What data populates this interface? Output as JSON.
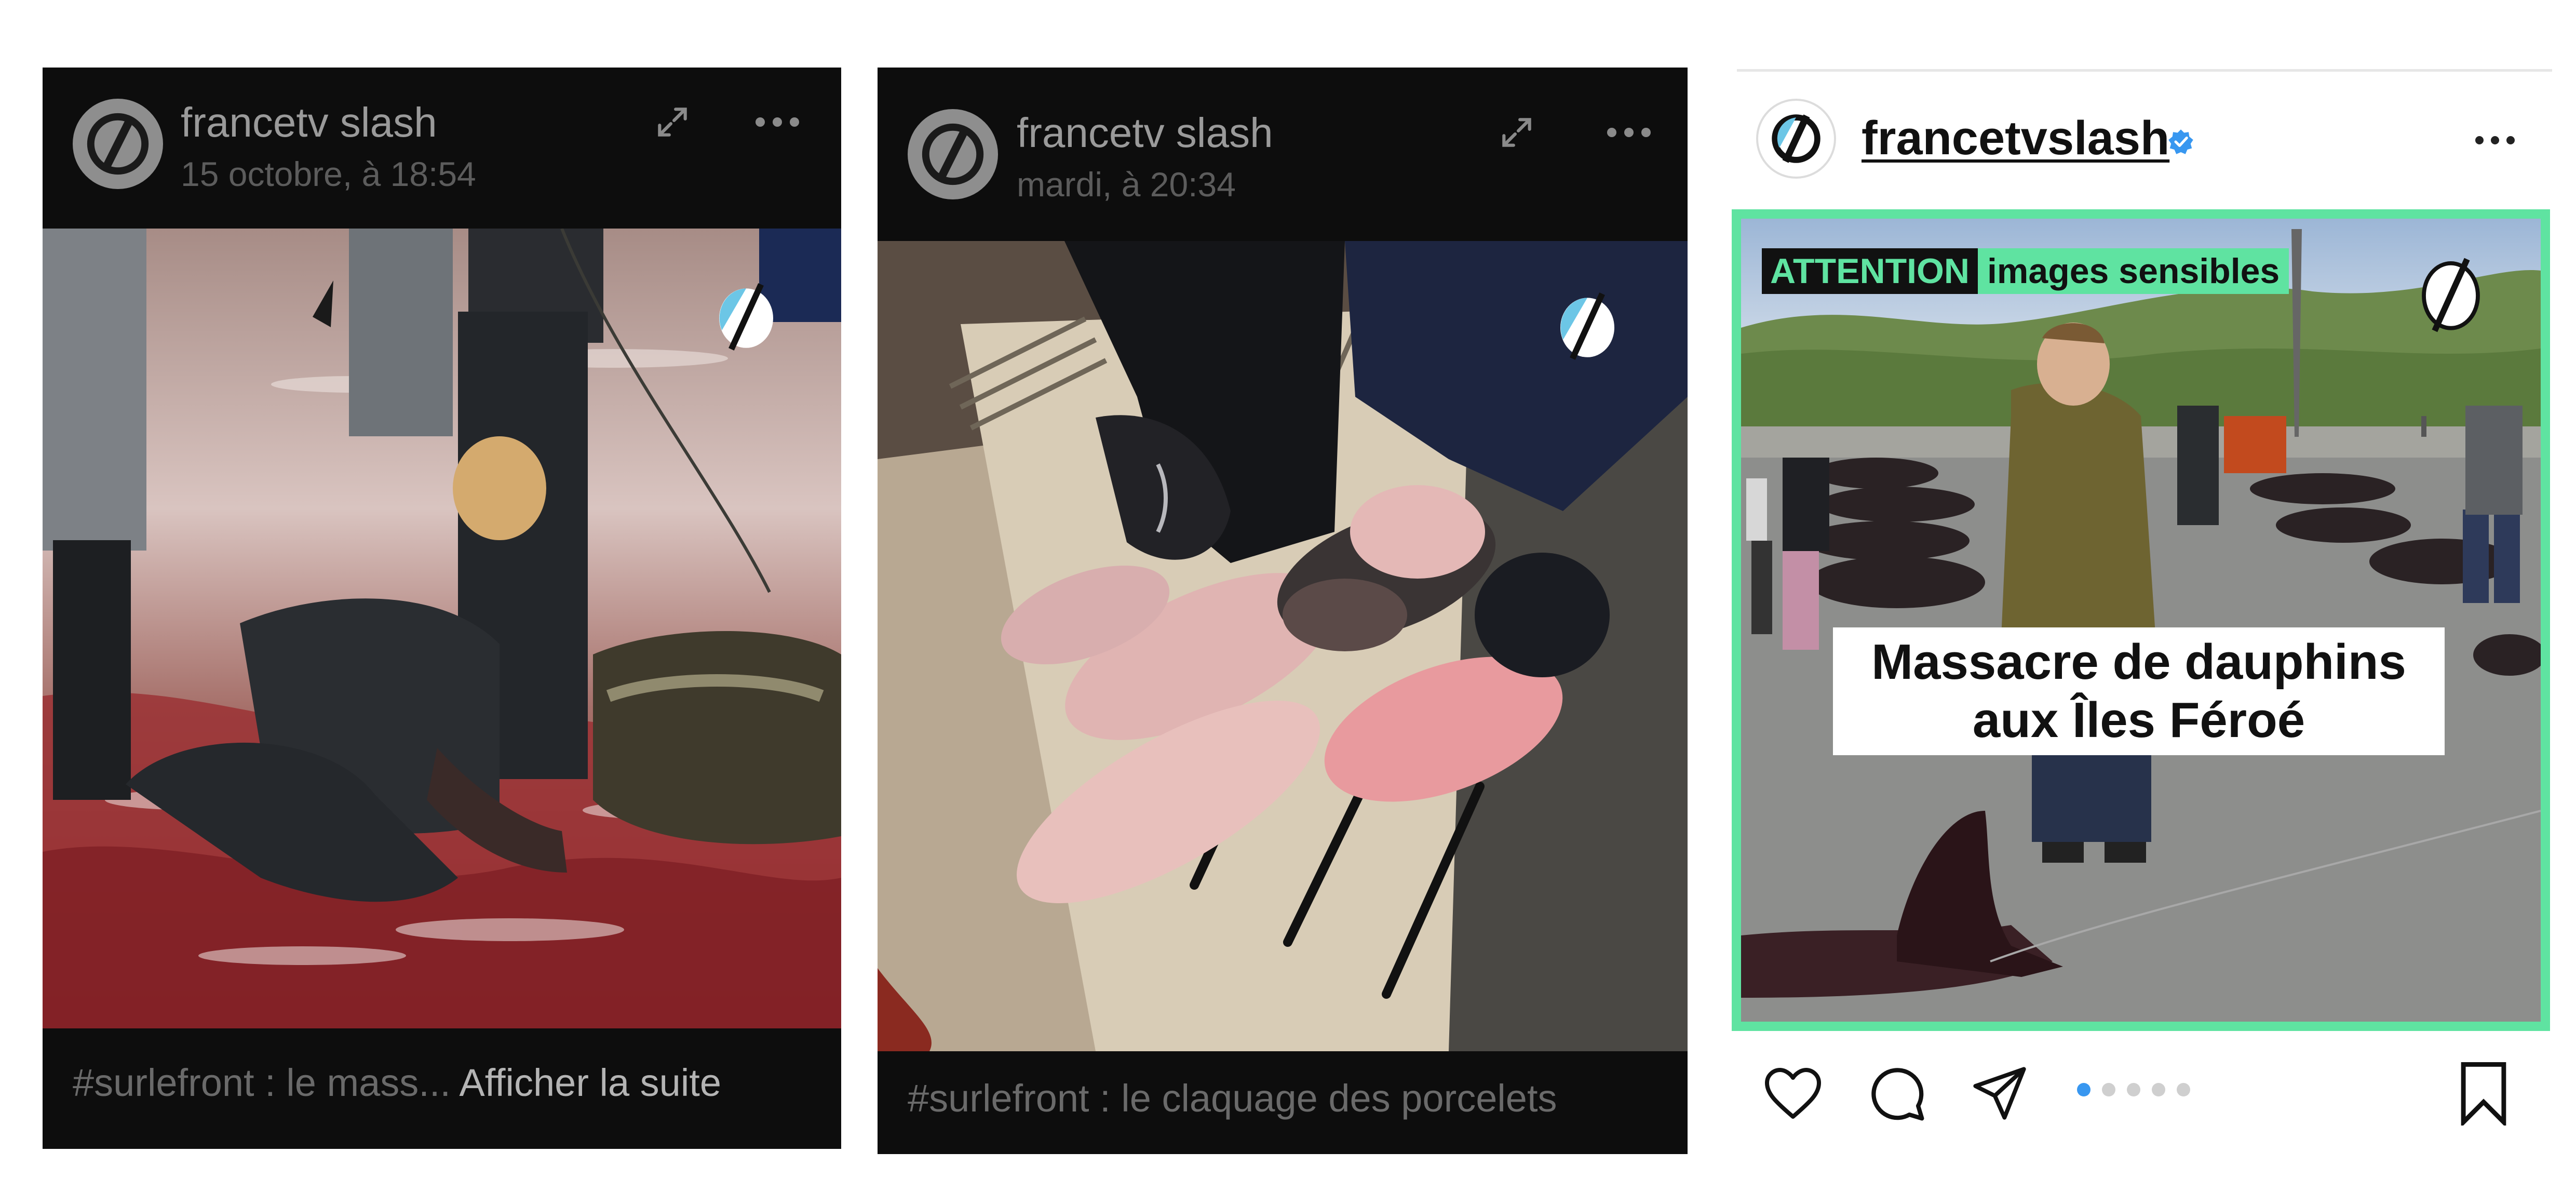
{
  "posts": [
    {
      "username": "francetv slash",
      "timestamp": "15 octobre, à 18:54",
      "caption": "#surlefront : le mass...",
      "more_label": "Afficher la suite",
      "icons": [
        "avatar-logo",
        "expand-icon",
        "more-icon",
        "slash-watermark-icon"
      ]
    },
    {
      "username": "francetv slash",
      "timestamp": "mardi, à 20:34",
      "caption": "#surlefront : le claquage des porcelets",
      "icons": [
        "avatar-logo",
        "expand-icon",
        "more-icon",
        "slash-watermark-icon"
      ]
    }
  ],
  "instagram_post": {
    "username": "francetvslash",
    "verified": true,
    "badge_attention": "ATTENTION",
    "badge_sensitive": "images sensibles",
    "headline_line1": "Massacre de dauphins",
    "headline_line2": "aux Îles Féroé",
    "carousel": {
      "total": 5,
      "active": 1
    },
    "icons": [
      "avatar-logo",
      "verified-icon",
      "more-icon",
      "slash-watermark-icon",
      "heart-icon",
      "comment-icon",
      "share-icon",
      "bookmark-icon"
    ]
  },
  "colors": {
    "dark_card": "#0d0d0d",
    "accent_green": "#5fe3a1",
    "verified_blue": "#3897f0",
    "watermark_blue": "#6cc6e6"
  }
}
